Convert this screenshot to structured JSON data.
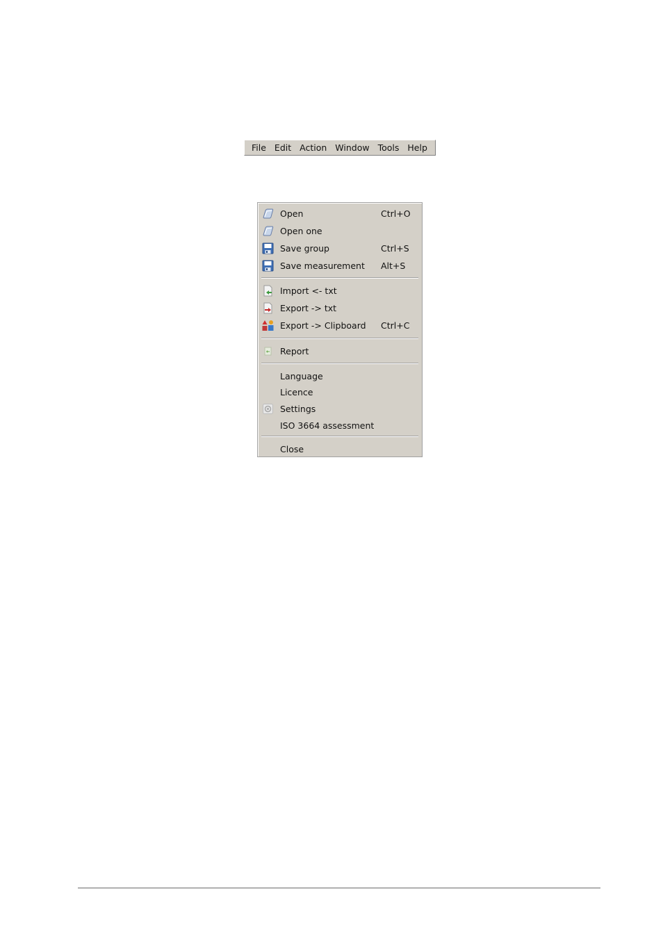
{
  "menubar": {
    "items": [
      "File",
      "Edit",
      "Action",
      "Window",
      "Tools",
      "Help"
    ]
  },
  "file_menu": {
    "items": [
      {
        "label": "Open",
        "shortcut": "Ctrl+O",
        "icon": "folder-open-icon"
      },
      {
        "label": "Open one",
        "shortcut": "",
        "icon": "folder-open-icon"
      },
      {
        "label": "Save group",
        "shortcut": "Ctrl+S",
        "icon": "floppy-disk-icon"
      },
      {
        "label": "Save measurement",
        "shortcut": "Alt+S",
        "icon": "floppy-disk-icon"
      },
      {
        "label": "Import <- txt",
        "shortcut": "",
        "icon": "import-file-icon"
      },
      {
        "label": "Export -> txt",
        "shortcut": "",
        "icon": "export-file-icon"
      },
      {
        "label": "Export -> Clipboard",
        "shortcut": "Ctrl+C",
        "icon": "clipboard-shapes-icon"
      },
      {
        "label": "Report",
        "shortcut": "",
        "icon": "report-icon"
      },
      {
        "label": "Language",
        "shortcut": "",
        "icon": ""
      },
      {
        "label": "Licence",
        "shortcut": "",
        "icon": ""
      },
      {
        "label": "Settings",
        "shortcut": "",
        "icon": "settings-icon"
      },
      {
        "label": "ISO 3664 assessment",
        "shortcut": "",
        "icon": ""
      },
      {
        "label": "Close",
        "shortcut": "",
        "icon": ""
      }
    ]
  },
  "colors": {
    "menu_background": "#d4d0c8",
    "separator_shadow": "#a0a0a0",
    "separator_highlight": "#ffffff",
    "page_background": "#ffffff",
    "footer_rule": "#b0b0b0"
  }
}
